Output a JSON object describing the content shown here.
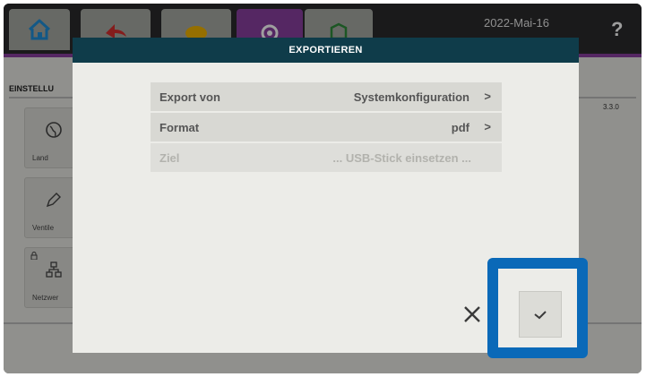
{
  "topbar": {
    "date": "2022-Mai-16",
    "help": "?",
    "tabs": [
      {
        "icon": "home-icon"
      },
      {
        "icon": "back-arrow-icon"
      },
      {
        "icon": "tool-icon"
      },
      {
        "icon": "gear-icon"
      },
      {
        "icon": "cube-icon"
      }
    ]
  },
  "background": {
    "section_title": "EINSTELLU",
    "version": "3.3.0",
    "cards": [
      {
        "label": "Land",
        "icon": "globe-icon"
      },
      {
        "label": "Ventile",
        "icon": "valve-icon"
      },
      {
        "label": "Netzwer",
        "icon": "network-icon"
      }
    ]
  },
  "dialog": {
    "title": "EXPORTIEREN",
    "rows": [
      {
        "label": "Export von",
        "value": "Systemkonfiguration",
        "chevron": ">"
      },
      {
        "label": "Format",
        "value": "pdf",
        "chevron": ">"
      },
      {
        "label": "Ziel",
        "value": "... USB-Stick einsetzen ...",
        "chevron": ""
      }
    ],
    "cancel_icon": "close-icon",
    "confirm_icon": "checkmark-icon"
  },
  "colors": {
    "accent_purple": "#8a3fa0",
    "dialog_header": "#0f3c4a",
    "highlight_blue": "#0a69b8"
  }
}
